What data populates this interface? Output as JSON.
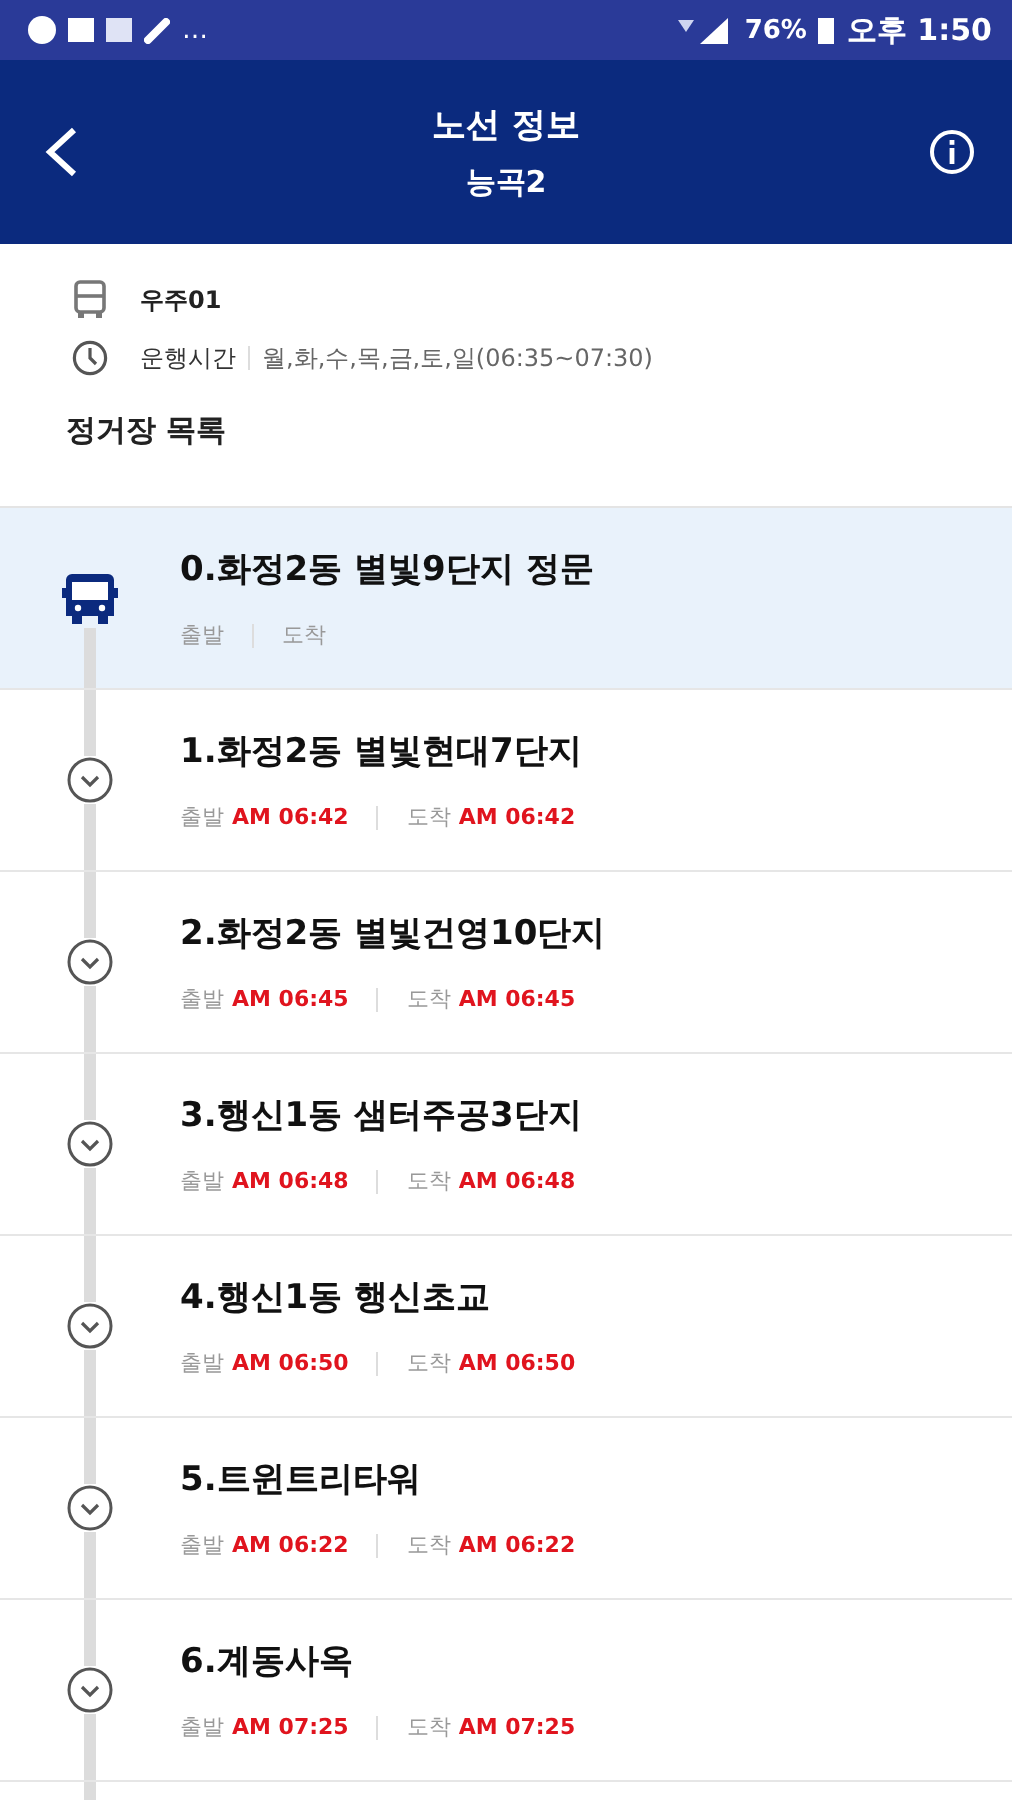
{
  "status_bar": {
    "overflow": "…",
    "battery": "76%",
    "time": "오후 1:50"
  },
  "header": {
    "title": "노선 정보",
    "subtitle": "능곡2"
  },
  "route_info": {
    "operator": "우주01",
    "hours_label": "운행시간",
    "hours": "월,화,수,목,금,토,일(06:35~07:30)"
  },
  "section_title": "정거장 목록",
  "stops": [
    {
      "name": "0.화정2동 별빛9단지 정문",
      "selected": true,
      "depart_label": "출발",
      "arrive_label": "도착"
    },
    {
      "name": "1.화정2동 별빛현대7단지",
      "selected": false,
      "depart_label": "출발",
      "depart_time": "AM 06:42",
      "arrive_label": "도착",
      "arrive_time": "AM 06:42"
    },
    {
      "name": "2.화정2동 별빛건영10단지",
      "selected": false,
      "depart_label": "출발",
      "depart_time": "AM 06:45",
      "arrive_label": "도착",
      "arrive_time": "AM 06:45"
    },
    {
      "name": "3.행신1동 샘터주공3단지",
      "selected": false,
      "depart_label": "출발",
      "depart_time": "AM 06:48",
      "arrive_label": "도착",
      "arrive_time": "AM 06:48"
    },
    {
      "name": "4.행신1동 행신초교",
      "selected": false,
      "depart_label": "출발",
      "depart_time": "AM 06:50",
      "arrive_label": "도착",
      "arrive_time": "AM 06:50"
    },
    {
      "name": "5.트윈트리타워",
      "selected": false,
      "depart_label": "출발",
      "depart_time": "AM 06:22",
      "arrive_label": "도착",
      "arrive_time": "AM 06:22"
    },
    {
      "name": "6.계동사옥",
      "selected": false,
      "depart_label": "출발",
      "depart_time": "AM 07:25",
      "arrive_label": "도착",
      "arrive_time": "AM 07:25"
    }
  ]
}
